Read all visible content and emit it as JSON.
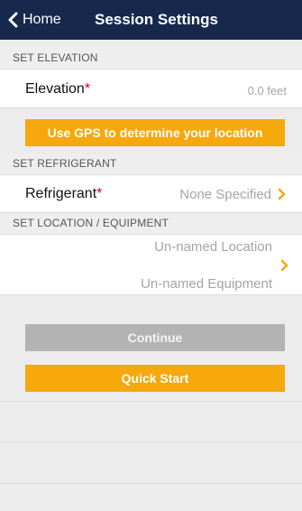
{
  "nav": {
    "back_label": "Home",
    "title": "Session Settings"
  },
  "elevation": {
    "header": "SET ELEVATION",
    "label": "Elevation",
    "required_mark": "*",
    "value": "0.0 feet",
    "gps_button": "Use GPS to determine your location"
  },
  "refrigerant": {
    "header": "SET REFRIGERANT",
    "label": "Refrigerant",
    "required_mark": "*",
    "value": "None Specified"
  },
  "location": {
    "header": "SET LOCATION / EQUIPMENT",
    "location_value": "Un-named Location",
    "equipment_value": "Un-named Equipment"
  },
  "buttons": {
    "continue": "Continue",
    "quick_start": "Quick Start"
  },
  "colors": {
    "navbar": "#16294d",
    "accent": "#f6a80d",
    "disabled": "#b3b3b3",
    "required": "#d0021b"
  }
}
